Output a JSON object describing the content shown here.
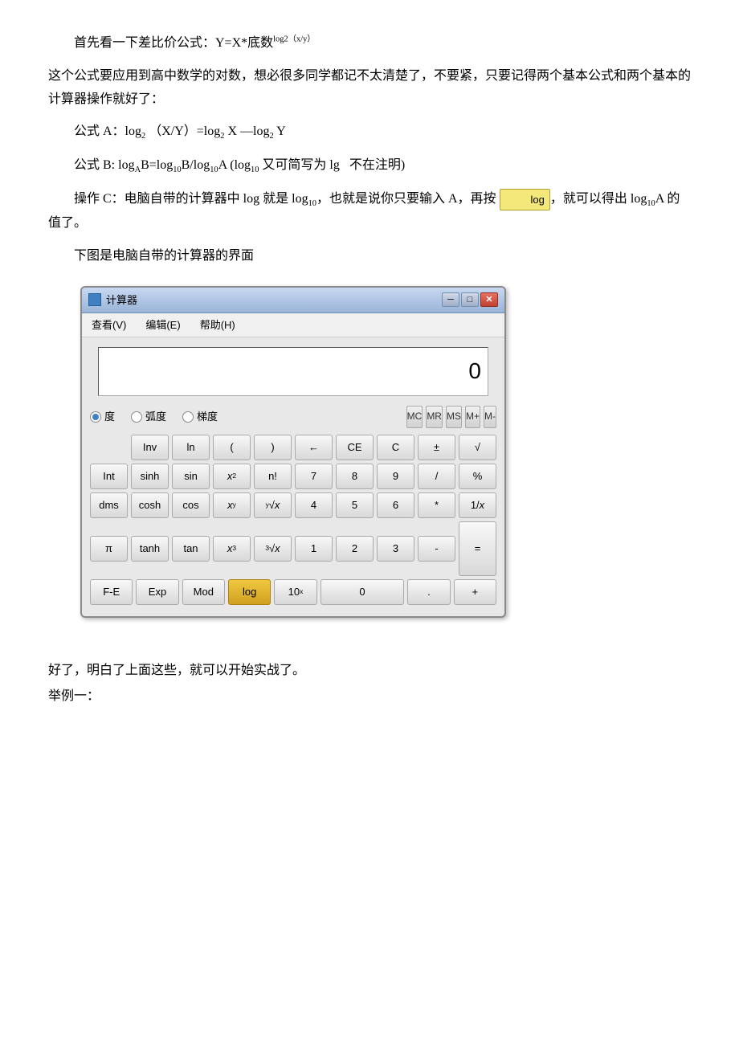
{
  "text": {
    "intro1": "首先看一下差比价公式：Y=X*底数",
    "intro1_sup": "log2（x/y）",
    "intro2": "这个公式要应用到高中数学的对数，想必很多同学都记不太清楚了，不要紧，只要记得两个基本公式和两个基本的计算器操作就好了：",
    "formulaA_label": "公式 A：",
    "formulaA": "log₂ （X/Y）=log₂ X —log₂ Y",
    "formulaB_label": "公式 B: ",
    "formulaB": "logₐB=log₁₀B/log₁₀A (log₁₀ 又可简写为 lg   不在注明)",
    "operationC_label": "操作 C：",
    "operationC1": "电脑自带的计算器中 log 就是 log₁₀，也就是说你只要输入 A，再按",
    "operationC2": "，就可以得出 log₁₀A 的值了。",
    "log_btn": "log",
    "diagram_label": "下图是电脑自带的计算器的界面",
    "conclusion1": "好了，明白了上面这些，就可以开始实战了。",
    "conclusion2": "举例一："
  },
  "calculator": {
    "title": "计算器",
    "display": "0",
    "menus": [
      "查看(V)",
      "编辑(E)",
      "帮助(H)"
    ],
    "radio": [
      {
        "label": "度",
        "selected": true
      },
      {
        "label": "弧度",
        "selected": false
      },
      {
        "label": "梯度",
        "selected": false
      }
    ],
    "mem_buttons": [
      "MC",
      "MR",
      "MS",
      "M+",
      "M-"
    ],
    "rows": [
      [
        "",
        "Inv",
        "ln",
        "(",
        ")",
        "←",
        "CE",
        "C",
        "±",
        "√"
      ],
      [
        "Int",
        "sinh",
        "sin",
        "x²",
        "n!",
        "7",
        "8",
        "9",
        "/",
        "%"
      ],
      [
        "dms",
        "cosh",
        "cos",
        "xʸ",
        "ʸ√x",
        "4",
        "5",
        "6",
        "*",
        "1/x"
      ],
      [
        "π",
        "tanh",
        "tan",
        "x³",
        "³√x",
        "1",
        "2",
        "3",
        "-",
        ""
      ],
      [
        "F-E",
        "Exp",
        "Mod",
        "log",
        "10ˣ",
        "0",
        "",
        ".",
        "+",
        ""
      ]
    ],
    "title_buttons": [
      "─",
      "□",
      "✕"
    ]
  }
}
